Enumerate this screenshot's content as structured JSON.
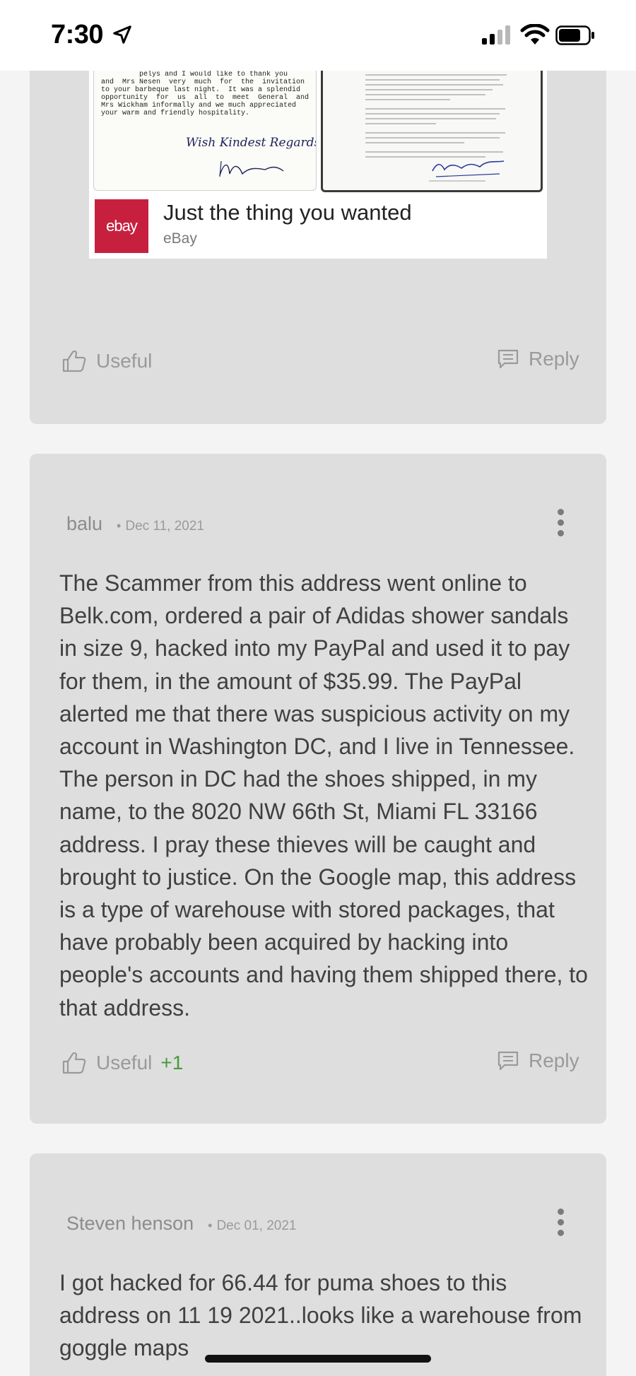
{
  "status_bar": {
    "time": "7:30"
  },
  "ad": {
    "letter_text": "         pelys and I would like to thank you\nand  Mrs Nesen  very  much  for  the  invitation\nto your barbeque last night.  It was a splendid\nopportunity  for  us  all  to  meet  General  and\nMrs Wickham informally and we much appreciated\nyour warm and friendly hospitality.",
    "logo_text": "ebay",
    "title": "Just the thing you wanted",
    "source": "eBay"
  },
  "cards": [
    {
      "useful_label": "Useful",
      "useful_count": "",
      "reply_label": "Reply"
    },
    {
      "author": "balu",
      "date": "Dec 11, 2021",
      "text": "The Scammer from this address went online to Belk.com, ordered a pair of Adidas shower sandals in size 9, hacked into my PayPal and used it to pay for them, in the amount of $35.99. The PayPal alerted me that there was suspicious activity on my account in Washington DC, and I live in Tennessee. The person in DC had the shoes shipped, in my name, to the 8020 NW 66th St, Miami FL 33166 address. I pray these thieves will be caught and brought to justice. On the Google map, this address is a type of warehouse with stored packages, that have probably been acquired by hacking into people's accounts and having them shipped there, to that address.",
      "useful_label": "Useful",
      "useful_count": "+1",
      "reply_label": "Reply"
    },
    {
      "author": "Steven henson",
      "date": "Dec 01, 2021",
      "text": "I got hacked for 66.44 for puma shoes to this address on 11 19 2021..looks like a warehouse from goggle maps"
    }
  ],
  "colors": {
    "card_bg": "#dedede",
    "ebay_red": "#c7203e",
    "useful_count_green": "#4a9a3a"
  }
}
